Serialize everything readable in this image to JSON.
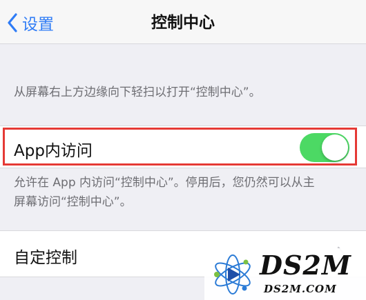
{
  "nav": {
    "back_label": "设置",
    "title": "控制中心"
  },
  "section1": {
    "description": "从屏幕右上方边缘向下轻扫以打开“控制中心”。"
  },
  "app_access": {
    "label": "App内访问",
    "toggle_on": true,
    "toggle_color": "#4cd964",
    "description_line1": "允许在 App 内访问“控制中心”。停用后，您仍然可以从主",
    "description_line2": "屏幕访问“控制中心”。"
  },
  "customize": {
    "label": "自定控制"
  },
  "watermark": {
    "brand": "DS2M",
    "site": "DS2M.COM"
  },
  "colors": {
    "accent": "#2f7cf6",
    "highlight": "#e53935"
  }
}
